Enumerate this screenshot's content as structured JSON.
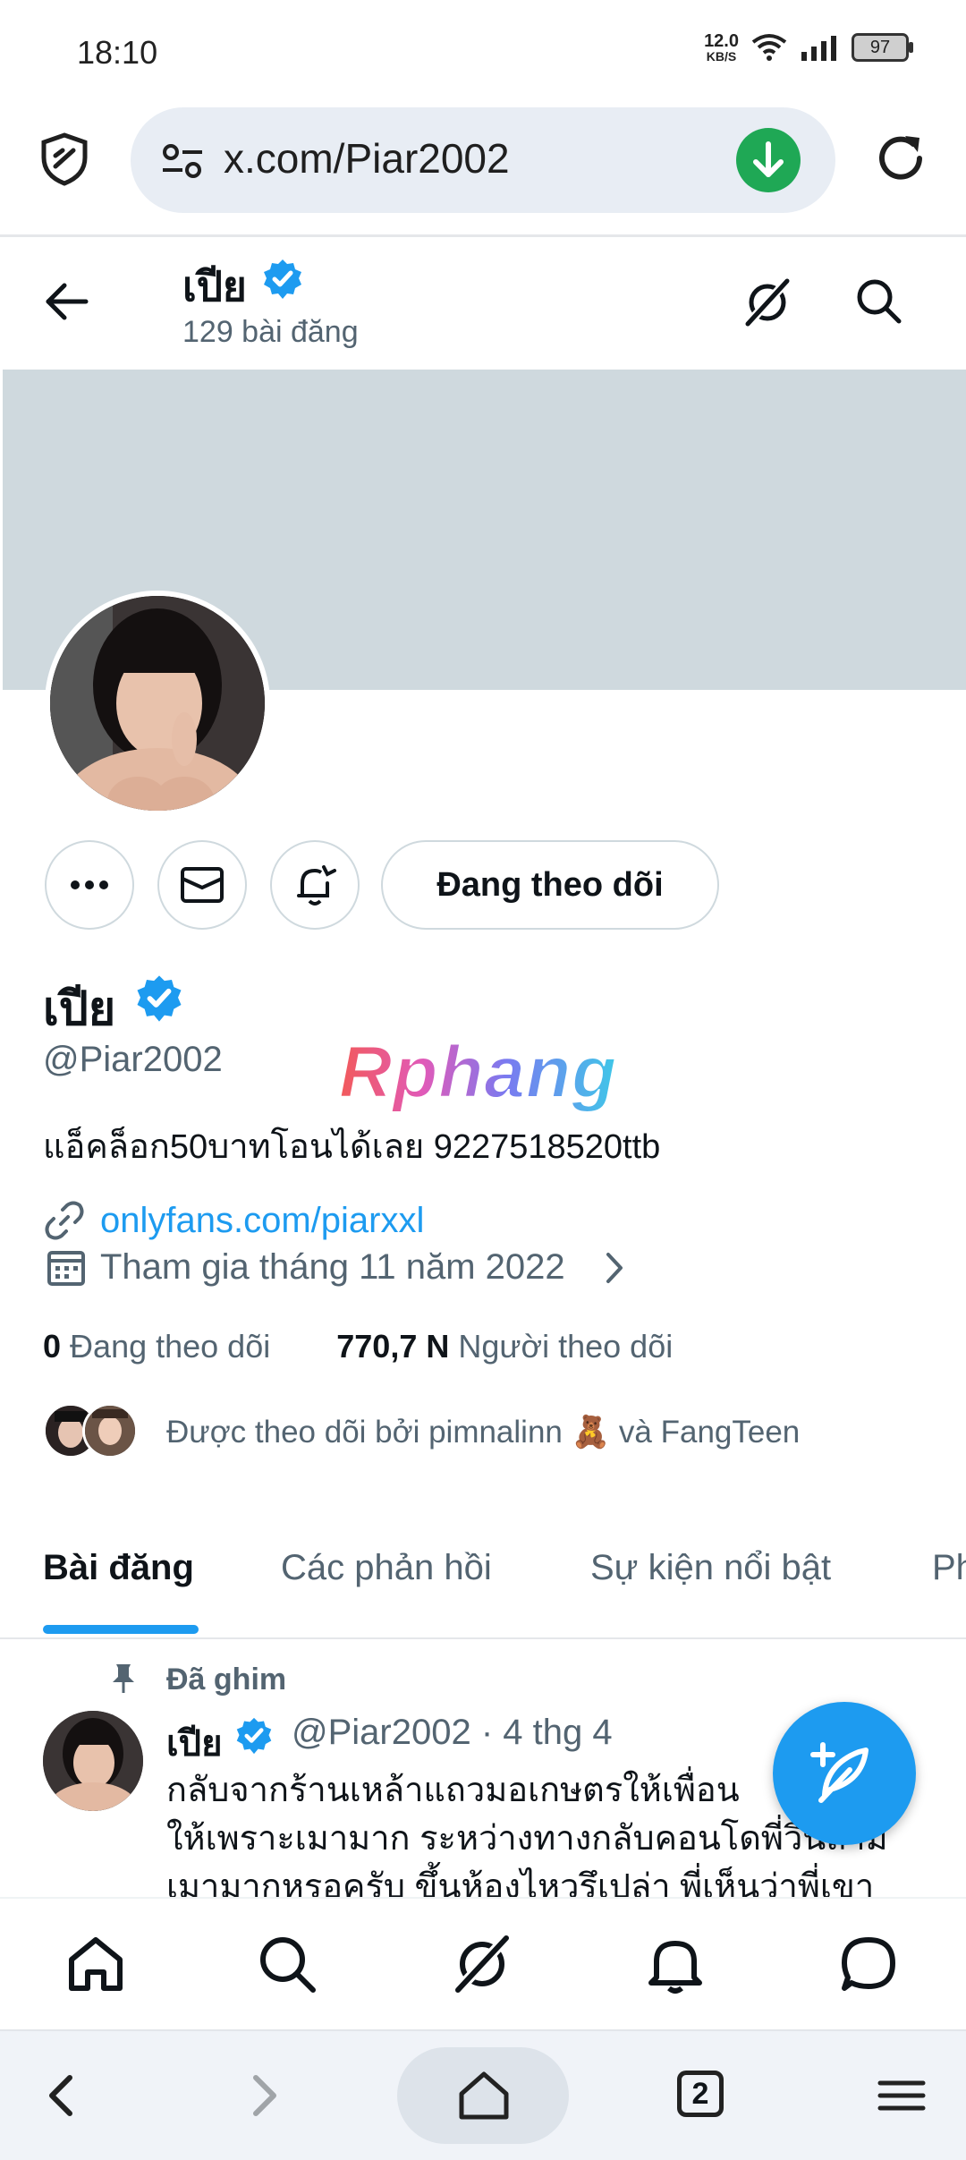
{
  "status_bar": {
    "time": "18:10",
    "net_speed_value": "12.0",
    "net_speed_unit": "KB/S",
    "battery": "97"
  },
  "browser": {
    "url": "x.com/Piar2002",
    "open_tabs": "2"
  },
  "header": {
    "name": "เปีย",
    "post_count": "129 bài đăng"
  },
  "profile": {
    "name": "เปีย",
    "handle": "@Piar2002",
    "bio": "แอ็คล็อก50บาทโอนได้เลย 9227518520ttb",
    "link": "onlyfans.com/piarxxl",
    "joined": "Tham gia tháng 11 năm 2022",
    "following_count": "0",
    "following_label": "Đang theo dõi",
    "followers_count": "770,7 N",
    "followers_label": "Người theo dõi",
    "followed_by": "Được theo dõi bởi pimnalinn 🧸 và FangTeen",
    "follow_button": "Đang theo dõi",
    "verified_color": "#1d9bf0"
  },
  "watermark": "Rphang",
  "tabs": [
    {
      "label": "Bài đăng",
      "active": true
    },
    {
      "label": "Các phản hồi",
      "active": false
    },
    {
      "label": "Sự kiện nổi bật",
      "active": false
    },
    {
      "label": "Ph",
      "active": false
    }
  ],
  "pinned_post": {
    "pinned_label": "Đã ghim",
    "author": "เปีย",
    "handle": "@Piar2002",
    "date": "· 4 thg 4",
    "text_line1": "กลับจากร้านเหล้าแถวมอเกษตรให้เพื่อน",
    "text_line2": "ให้เพราะเมามาก ระหว่างทางกลับคอนโดพี่วินถาม",
    "text_line3": "เมามากหรอครับ ขึ้นห้องไหวรึเปล่า พี่เห็นว่าพี่เขา"
  },
  "icons": {
    "browser_shield": "shield-icon",
    "url_tune": "tune-icon",
    "download": "download-icon",
    "reload": "reload-icon",
    "back": "back-arrow-icon",
    "grok": "grok-icon",
    "search": "search-icon",
    "more": "more-icon",
    "message": "mail-icon",
    "notify": "bell-plus-icon",
    "link": "link-icon",
    "calendar": "calendar-icon",
    "pin": "pin-icon",
    "compose": "compose-icon",
    "nav_home": "home-icon",
    "nav_search": "search-icon",
    "nav_grok": "grok-icon",
    "nav_notifications": "bell-icon",
    "nav_messages": "chat-icon",
    "browser_back": "chevron-left-icon",
    "browser_forward": "chevron-right-icon",
    "browser_home": "home-icon",
    "browser_menu": "menu-icon"
  }
}
